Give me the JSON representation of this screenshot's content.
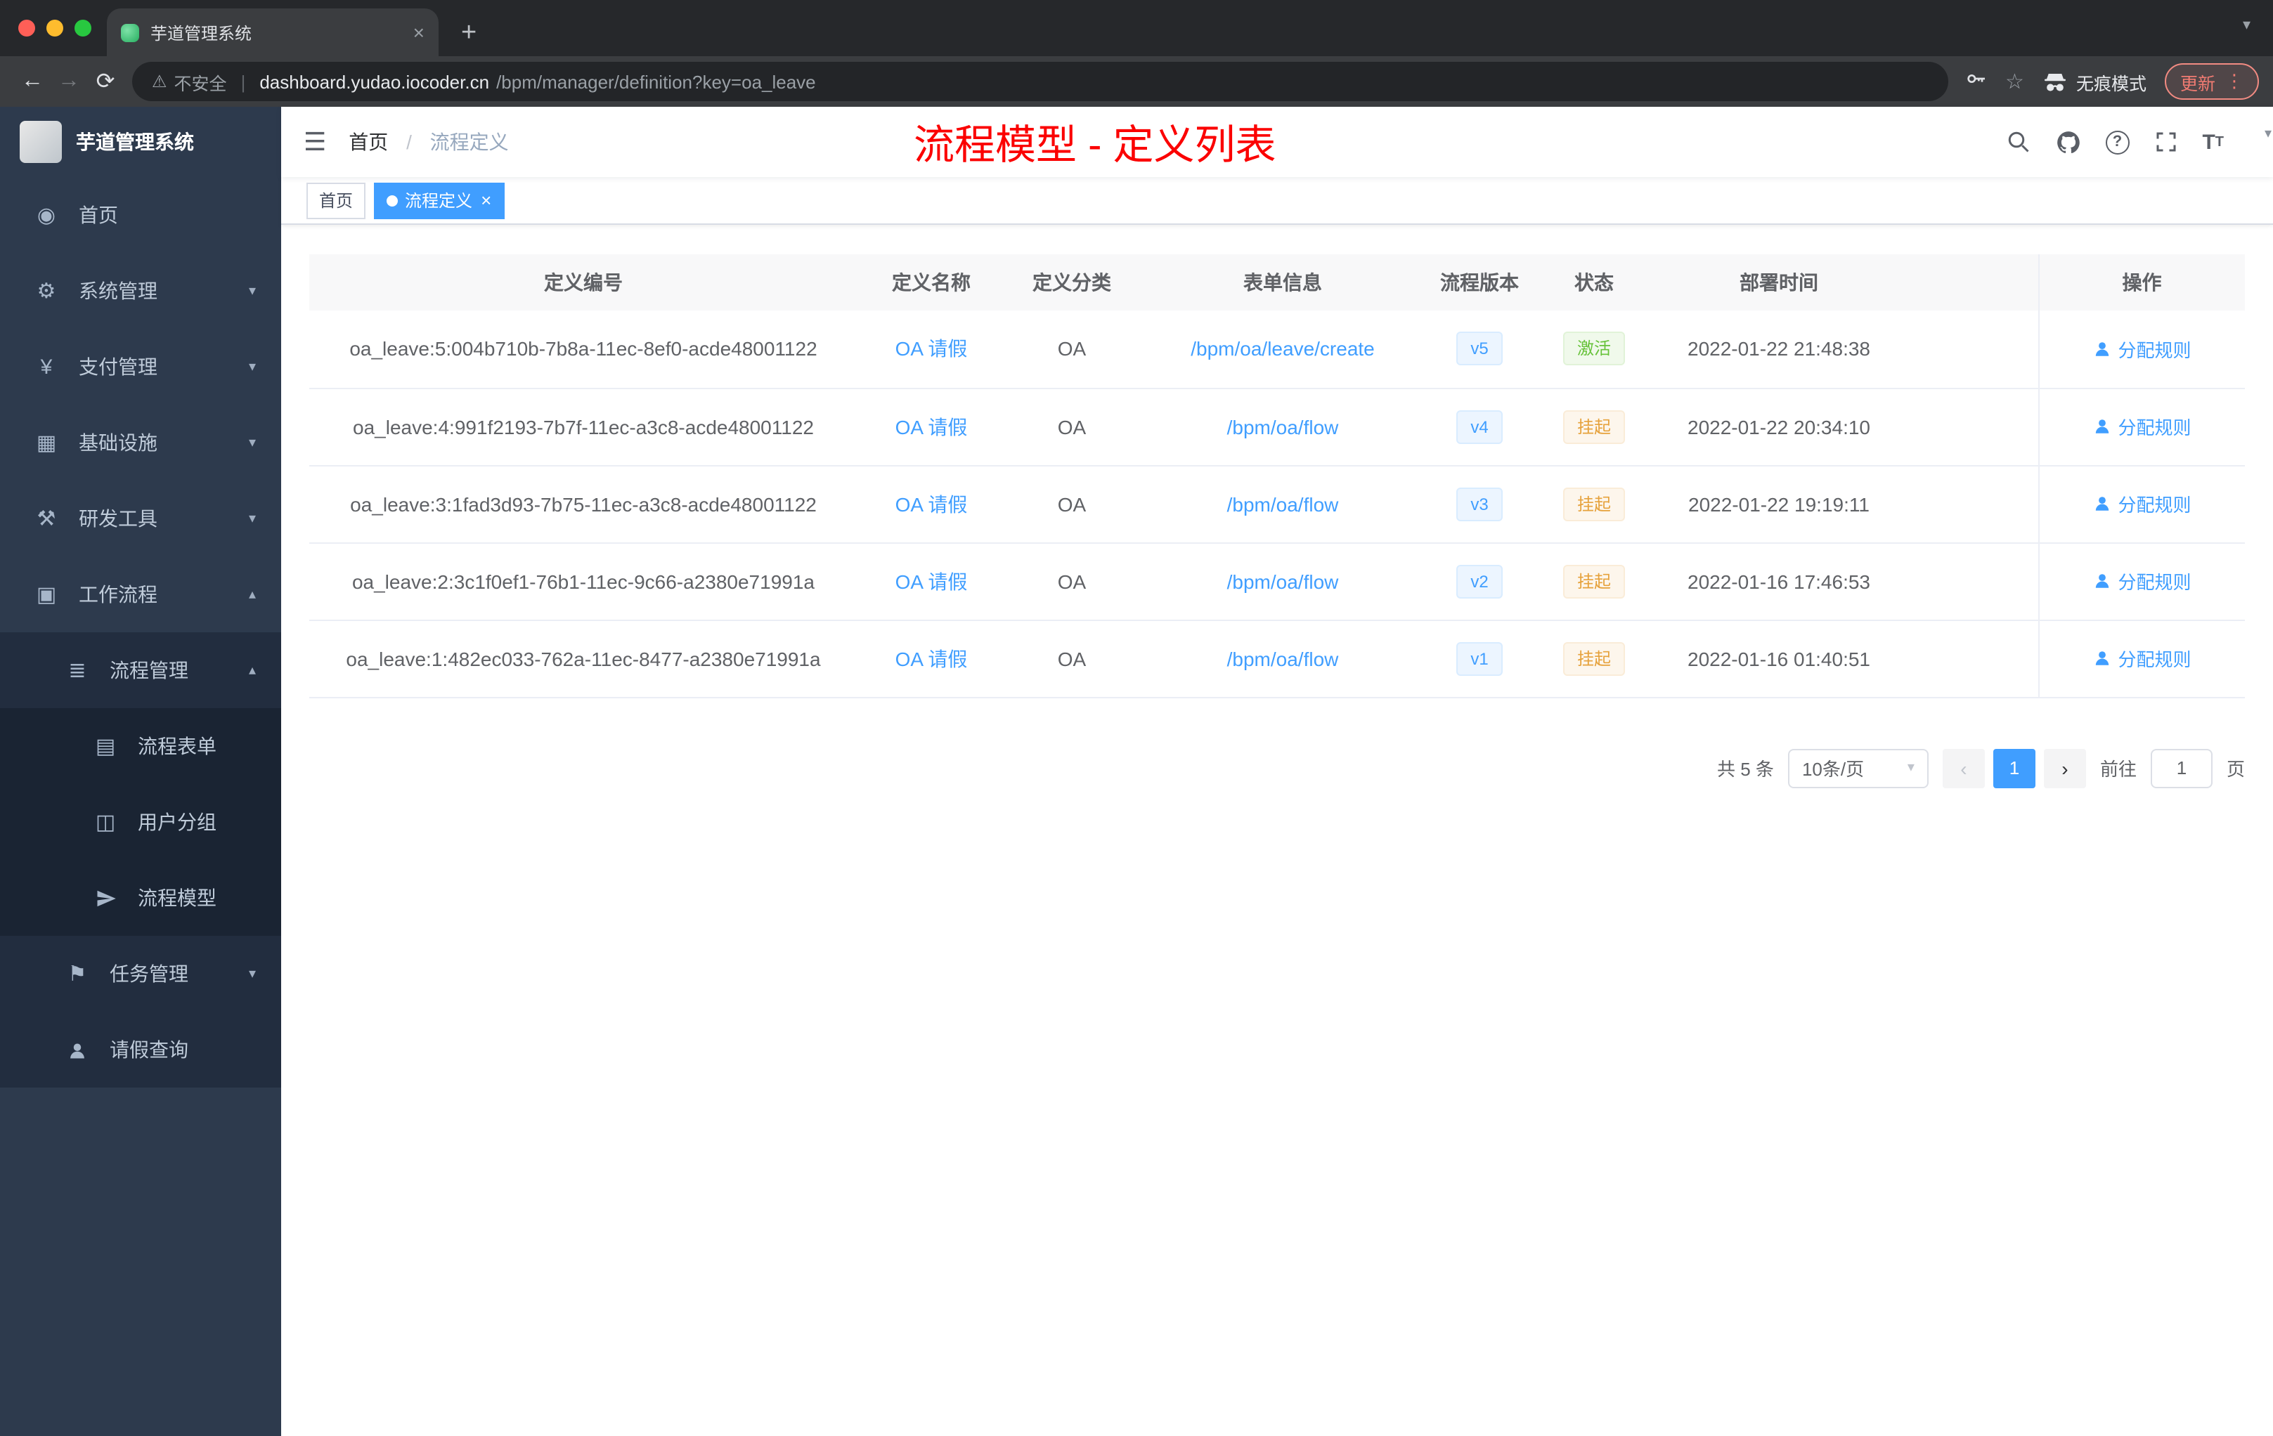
{
  "colors": {
    "accent": "#409EFF",
    "success": "#67c23a",
    "warning": "#e6a23c",
    "annotation": "#ff0000",
    "sidebar_bg": "#2d3a4d"
  },
  "icons": {
    "close": "×",
    "new_tab": "+",
    "tab_search_caret": "▾",
    "back": "←",
    "forward": "→",
    "reload": "⟳",
    "warning": "⚠",
    "url_divider": "|",
    "star": "☆",
    "menu_dots": "⋮",
    "hamburger": "☰",
    "caret_down": "▾",
    "caret_up": "▴",
    "help_mark": "?",
    "font_large": "T",
    "font_small": "T",
    "prev": "‹",
    "next": "›",
    "select_caret": "▾",
    "avatar_caret": "▾"
  },
  "browser": {
    "tab": {
      "title": "芋道管理系统"
    },
    "toolbar": {
      "security_label": "不安全",
      "url_host": "dashboard.yudao.iocoder.cn",
      "url_path": "/bpm/manager/definition?key=oa_leave",
      "incognito_label": "无痕模式",
      "update_label": "更新"
    }
  },
  "sidebar": {
    "logo_title": "芋道管理系统",
    "items": [
      {
        "label": "首页",
        "icon": "dashboard-icon",
        "glyph": "◉"
      },
      {
        "label": "系统管理",
        "icon": "gear-icon",
        "glyph": "⚙"
      },
      {
        "label": "支付管理",
        "icon": "yen-icon",
        "glyph": "¥"
      },
      {
        "label": "基础设施",
        "icon": "infrastructure-icon",
        "glyph": "▦"
      },
      {
        "label": "研发工具",
        "icon": "tools-icon",
        "glyph": "⚒"
      },
      {
        "label": "工作流程",
        "icon": "workflow-icon",
        "glyph": "▣"
      },
      {
        "label": "流程管理",
        "icon": "process-list-icon",
        "glyph": "≣"
      },
      {
        "label": "流程表单",
        "icon": "form-icon",
        "glyph": "▤"
      },
      {
        "label": "用户分组",
        "icon": "user-group-icon",
        "glyph": "◫"
      },
      {
        "label": "流程模型",
        "icon": "paper-plane-icon"
      },
      {
        "label": "任务管理",
        "icon": "task-flag-icon",
        "glyph": "⚑"
      },
      {
        "label": "请假查询",
        "icon": "user-icon"
      }
    ]
  },
  "navbar": {
    "breadcrumb": {
      "home": "首页",
      "separator": "/",
      "current": "流程定义"
    },
    "annotation": "流程模型 - 定义列表"
  },
  "tags": [
    {
      "label": "首页",
      "active": false
    },
    {
      "label": "流程定义",
      "active": true
    }
  ],
  "table": {
    "headers": [
      "定义编号",
      "定义名称",
      "定义分类",
      "表单信息",
      "流程版本",
      "状态",
      "部署时间",
      "操作"
    ],
    "action_label": "分配规则",
    "rows": [
      {
        "id": "oa_leave:5:004b710b-7b8a-11ec-8ef0-acde48001122",
        "name": "OA 请假",
        "category": "OA",
        "form": "/bpm/oa/leave/create",
        "version": "v5",
        "status": "激活",
        "status_type": "success",
        "time": "2022-01-22 21:48:38"
      },
      {
        "id": "oa_leave:4:991f2193-7b7f-11ec-a3c8-acde48001122",
        "name": "OA 请假",
        "category": "OA",
        "form": "/bpm/oa/flow",
        "version": "v4",
        "status": "挂起",
        "status_type": "warning",
        "time": "2022-01-22 20:34:10"
      },
      {
        "id": "oa_leave:3:1fad3d93-7b75-11ec-a3c8-acde48001122",
        "name": "OA 请假",
        "category": "OA",
        "form": "/bpm/oa/flow",
        "version": "v3",
        "status": "挂起",
        "status_type": "warning",
        "time": "2022-01-22 19:19:11"
      },
      {
        "id": "oa_leave:2:3c1f0ef1-76b1-11ec-9c66-a2380e71991a",
        "name": "OA 请假",
        "category": "OA",
        "form": "/bpm/oa/flow",
        "version": "v2",
        "status": "挂起",
        "status_type": "warning",
        "time": "2022-01-16 17:46:53"
      },
      {
        "id": "oa_leave:1:482ec033-762a-11ec-8477-a2380e71991a",
        "name": "OA 请假",
        "category": "OA",
        "form": "/bpm/oa/flow",
        "version": "v1",
        "status": "挂起",
        "status_type": "warning",
        "time": "2022-01-16 01:40:51"
      }
    ]
  },
  "pagination": {
    "total": "共 5 条",
    "page_size": "10条/页",
    "current_page": "1",
    "goto_label": "前往",
    "goto_value": "1",
    "page_label": "页"
  }
}
